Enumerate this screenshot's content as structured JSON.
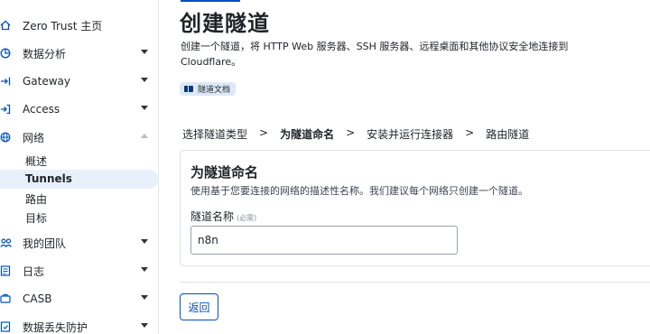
{
  "sidebar": {
    "items": [
      {
        "label": "Zero Trust 主页",
        "icon": "home-icon"
      },
      {
        "label": "数据分析",
        "icon": "analytics-icon"
      },
      {
        "label": "Gateway",
        "icon": "gateway-icon"
      },
      {
        "label": "Access",
        "icon": "access-icon"
      },
      {
        "label": "网络",
        "icon": "network-icon"
      },
      {
        "label": "我的团队",
        "icon": "team-icon"
      },
      {
        "label": "日志",
        "icon": "logs-icon"
      },
      {
        "label": "CASB",
        "icon": "casb-icon"
      },
      {
        "label": "数据丢失防护",
        "icon": "dlp-icon"
      }
    ],
    "network_subitems": [
      {
        "label": "概述"
      },
      {
        "label": "Tunnels",
        "active": true
      },
      {
        "label": "路由"
      },
      {
        "label": "目标"
      }
    ]
  },
  "page": {
    "title": "创建隧道",
    "description": "创建一个隧道，将 HTTP Web 服务器、SSH 服务器、远程桌面和其他协议安全地连接到 Cloudflare。",
    "doc_link": "隧道文档"
  },
  "steps": [
    {
      "label": "选择隧道类型"
    },
    {
      "label": "为隧道命名",
      "current": true
    },
    {
      "label": "安装并运行连接器"
    },
    {
      "label": "路由隧道"
    }
  ],
  "step_separator": ">",
  "form": {
    "title": "为隧道命名",
    "description": "使用基于您要连接的网络的描述性名称。我们建议每个网络只创建一个隧道。",
    "field_label": "隧道名称",
    "field_required": "(必需)",
    "field_value": "n8n"
  },
  "actions": {
    "back_label": "返回"
  },
  "colors": {
    "accent": "#0051c3",
    "active_bg": "#e8f0fb",
    "badge_bg": "#dde9f7"
  }
}
